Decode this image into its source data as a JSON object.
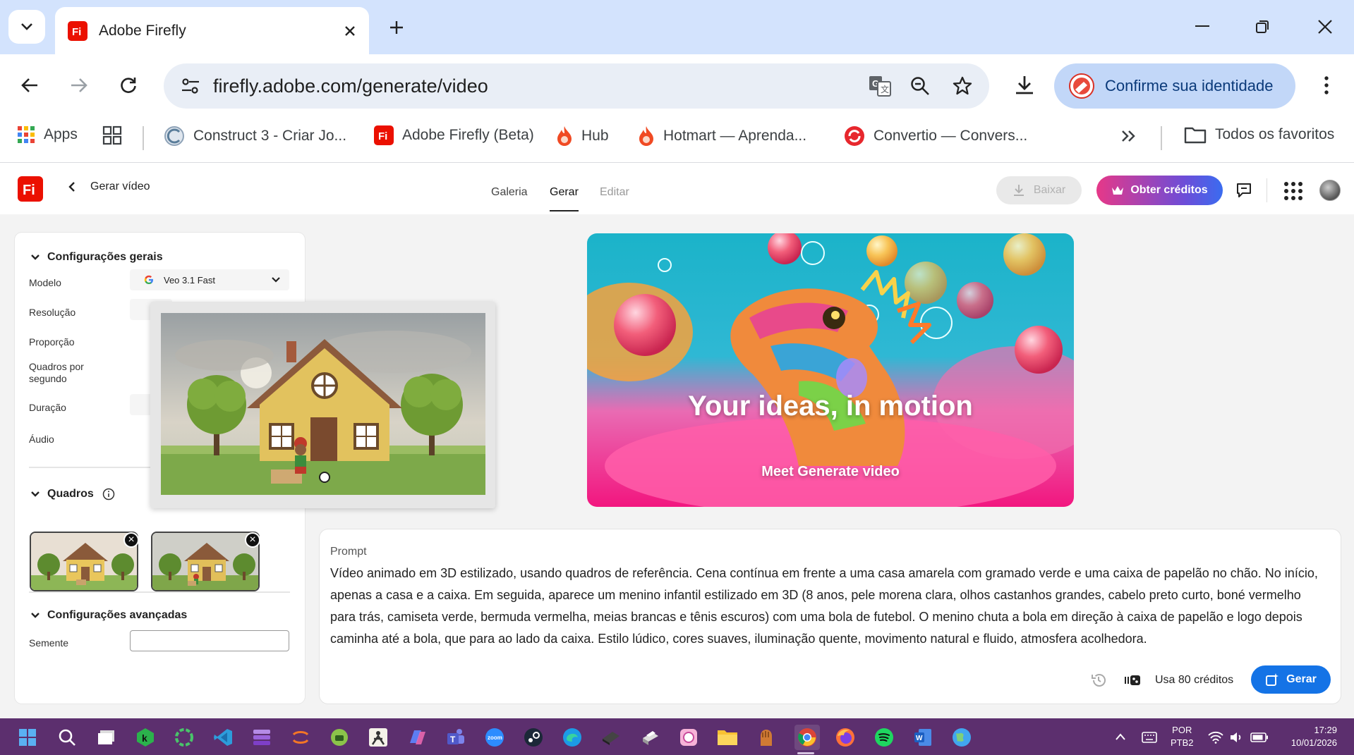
{
  "browser": {
    "tab_title": "Adobe Firefly",
    "url": "firefly.adobe.com/generate/video",
    "identity_label": "Confirme sua identidade",
    "bookmarks": {
      "apps": "Apps",
      "items": [
        "Construct 3 - Criar Jo...",
        "Adobe Firefly (Beta)",
        "Hub",
        "Hotmart — Aprenda...",
        "Convertio — Convers..."
      ],
      "all_favorites": "Todos os favoritos"
    }
  },
  "app": {
    "back_label": "Gerar vídeo",
    "nav": [
      "Galeria",
      "Gerar",
      "Editar"
    ],
    "active_nav": "Gerar",
    "download_label": "Baixar",
    "credits_button": "Obter créditos"
  },
  "settings": {
    "general_title": "Configurações gerais",
    "model_label": "Modelo",
    "model_value": "Veo 3.1 Fast",
    "resolution_label": "Resolução",
    "aspect_label": "Proporção",
    "fps_label_1": "Quadros por",
    "fps_label_2": "segundo",
    "duration_label": "Duração",
    "audio_label": "Áudio",
    "frames_title": "Quadros",
    "advanced_title": "Configurações avançadas",
    "seed_label": "Semente",
    "seed_value": ""
  },
  "banner": {
    "headline": "Your ideas, in motion",
    "subline": "Meet Generate video"
  },
  "prompt": {
    "label": "Prompt",
    "text": "Vídeo animado em 3D estilizado, usando quadros de referência. Cena contínua em frente a uma casa amarela com gramado verde e uma caixa de papelão no chão. No início, apenas a casa e a caixa. Em seguida, aparece um menino infantil estilizado em 3D (8 anos, pele morena clara, olhos castanhos grandes, cabelo preto curto, boné vermelho para trás, camiseta verde, bermuda vermelha, meias brancas e tênis escuros) com uma bola de futebol. O menino chuta a bola em direção à caixa de papelão e logo depois caminha até a bola, que para ao lado da caixa. Estilo lúdico, cores suaves, iluminação quente, movimento natural e fluido, atmosfera acolhedora.",
    "credits_text": "Usa 80 créditos",
    "generate_button": "Gerar"
  },
  "taskbar": {
    "lang_1": "POR",
    "lang_2": "PTB2",
    "time": "17:29",
    "date": "10/01/2026"
  },
  "colors": {
    "tabbar_bg": "#d3e3fd",
    "adobe_red": "#eb1000",
    "credits_gradient": "#e63888",
    "generate_blue": "#1473e6",
    "taskbar": "#5c2f6e"
  }
}
